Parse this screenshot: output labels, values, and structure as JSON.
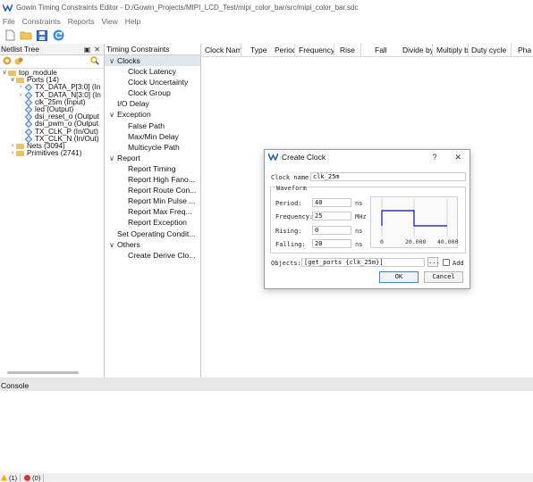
{
  "window": {
    "title": "Gowin Timing Constraints Editor - D:/Gowin_Projects/MIPI_LCD_Test/mipi_color_bar/src/mipi_color_bar.sdc"
  },
  "menu": [
    "File",
    "Constraints",
    "Reports",
    "View",
    "Help"
  ],
  "toolbar": {
    "icons": [
      "new-file-icon",
      "open-folder-icon",
      "save-icon",
      "refresh-icon"
    ]
  },
  "netlist": {
    "title": "Netlist Tree",
    "header_buttons": [
      "▣",
      "✕"
    ],
    "tree": [
      {
        "label": "top_module",
        "arrow": "∨",
        "indent": 0,
        "icon": "folder"
      },
      {
        "label": "Ports (14)",
        "arrow": "∨",
        "indent": 1,
        "icon": "folder"
      },
      {
        "label": "TX_DATA_P[3:0] (In",
        "arrow": "›",
        "indent": 2,
        "icon": "port"
      },
      {
        "label": "TX_DATA_N[3:0] (In",
        "arrow": "›",
        "indent": 2,
        "icon": "port"
      },
      {
        "label": "clk_25m (Input)",
        "arrow": "",
        "indent": 2,
        "icon": "port"
      },
      {
        "label": "led (Output)",
        "arrow": "",
        "indent": 2,
        "icon": "port"
      },
      {
        "label": "dsi_reset_o (Output",
        "arrow": "",
        "indent": 2,
        "icon": "port"
      },
      {
        "label": "dsi_pwm_o (Output",
        "arrow": "",
        "indent": 2,
        "icon": "port"
      },
      {
        "label": "TX_CLK_P (In/Out)",
        "arrow": "",
        "indent": 2,
        "icon": "port"
      },
      {
        "label": "TX_CLK_N (In/Out)",
        "arrow": "",
        "indent": 2,
        "icon": "port"
      },
      {
        "label": "Nets (3094)",
        "arrow": "›",
        "indent": 1,
        "icon": "folder"
      },
      {
        "label": "Primitives (2741)",
        "arrow": "›",
        "indent": 1,
        "icon": "folder"
      }
    ]
  },
  "constraints": {
    "title": "Timing Constraints",
    "items": [
      {
        "label": "Clocks",
        "arrow": "∨",
        "indent": 0,
        "selected": true
      },
      {
        "label": "Clock Latency",
        "arrow": "",
        "indent": 2,
        "selected": false
      },
      {
        "label": "Clock Uncertainty",
        "arrow": "",
        "indent": 2,
        "selected": false
      },
      {
        "label": "Clock Group",
        "arrow": "",
        "indent": 2,
        "selected": false
      },
      {
        "label": "I/O Delay",
        "arrow": "",
        "indent": 1,
        "selected": false
      },
      {
        "label": "Exception",
        "arrow": "∨",
        "indent": 0,
        "selected": false
      },
      {
        "label": "False Path",
        "arrow": "",
        "indent": 2,
        "selected": false
      },
      {
        "label": "Max/Min Delay",
        "arrow": "",
        "indent": 2,
        "selected": false
      },
      {
        "label": "Multicycle Path",
        "arrow": "",
        "indent": 2,
        "selected": false
      },
      {
        "label": "Report",
        "arrow": "∨",
        "indent": 0,
        "selected": false
      },
      {
        "label": "Report Timing",
        "arrow": "",
        "indent": 2,
        "selected": false
      },
      {
        "label": "Report High Fano...",
        "arrow": "",
        "indent": 2,
        "selected": false
      },
      {
        "label": "Report Route Con...",
        "arrow": "",
        "indent": 2,
        "selected": false
      },
      {
        "label": "Report Min Pulse ...",
        "arrow": "",
        "indent": 2,
        "selected": false
      },
      {
        "label": "Report Max Freq...",
        "arrow": "",
        "indent": 2,
        "selected": false
      },
      {
        "label": "Report Exception",
        "arrow": "",
        "indent": 2,
        "selected": false
      },
      {
        "label": "Set Operating Condit...",
        "arrow": "",
        "indent": 1,
        "selected": false
      },
      {
        "label": "Others",
        "arrow": "∨",
        "indent": 0,
        "selected": false
      },
      {
        "label": "Create Derive Clo...",
        "arrow": "",
        "indent": 2,
        "selected": false
      }
    ]
  },
  "table": {
    "columns": [
      "Clock Nam",
      "Type",
      "Period",
      "Frequency",
      "Rise",
      "Fall",
      "Divide by",
      "Multiply by",
      "Duty cycle",
      "Pha"
    ]
  },
  "console": {
    "title": "Console"
  },
  "status": {
    "warnings": "(1)",
    "errors": "(0)"
  },
  "dialog": {
    "title": "Create Clock",
    "help": "?",
    "close": "✕",
    "clock_name_label": "Clock name:",
    "clock_name": "clk_25m",
    "waveform_label": "Waveform",
    "period_label": "Period:",
    "period": "40",
    "period_unit": "ns",
    "frequency_label": "Frequency:",
    "frequency": "25",
    "frequency_unit": "MHz",
    "rising_label": "Rising:",
    "rising": "0",
    "rising_unit": "ns",
    "falling_label": "Falling:",
    "falling": "20",
    "falling_unit": "ns",
    "graph_ticks": [
      "0",
      "20.000",
      "40.000"
    ],
    "objects_label": "Objects:",
    "objects": "[get_ports {clk_25m}]",
    "browse": "...",
    "add_label": "Add",
    "ok": "OK",
    "cancel": "Cancel"
  },
  "colors": {
    "accent": "#4a7fc0",
    "wave": "#2e2edc",
    "selection": "#dfe6ef"
  }
}
